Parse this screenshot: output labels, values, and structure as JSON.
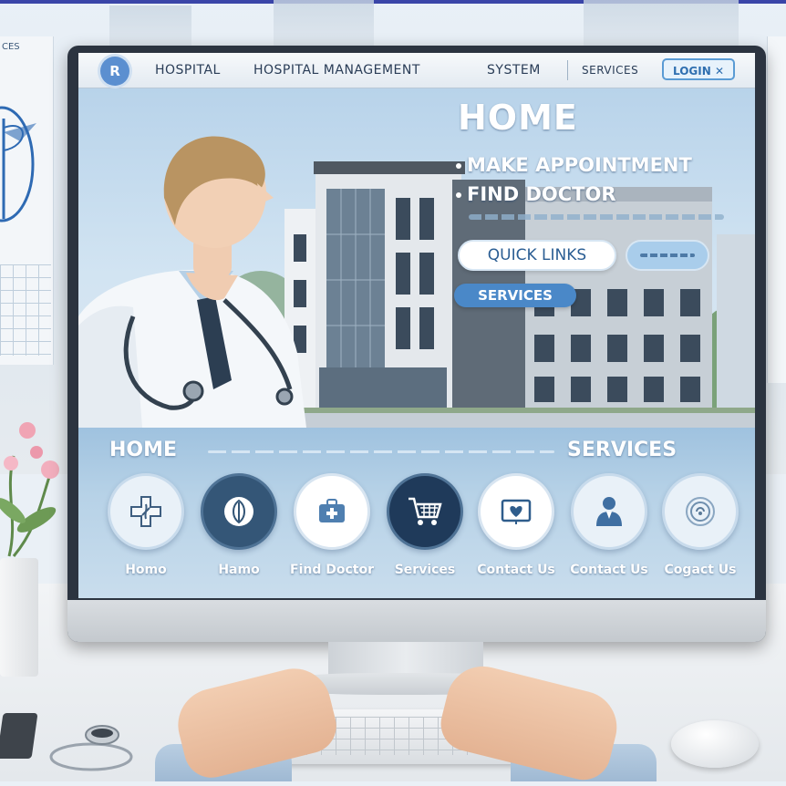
{
  "header": {
    "logo_glyph": "R",
    "brand": "HOSPITAL",
    "title": "HOSPITAL MANAGEMENT",
    "subtitle": "SYSTEM",
    "services_link": "SERVICES",
    "login_label": "LOGIN ✕"
  },
  "hero": {
    "title": "HOME",
    "links": [
      "MAKE APPOINTMENT",
      "FIND DOCTOR"
    ],
    "quick_links_label": "QUICK LINKS",
    "services_label": "SERVICES"
  },
  "lower": {
    "home_heading": "HOME",
    "services_heading": "SERVICES",
    "items": [
      {
        "label": "Homo",
        "icon": "plus-icon"
      },
      {
        "label": "Hamo",
        "icon": "leaf-icon"
      },
      {
        "label": "Find Doctor",
        "icon": "medical-kit-icon"
      },
      {
        "label": "Services",
        "icon": "cart-icon"
      },
      {
        "label": "Contact Us",
        "icon": "heart-monitor-icon"
      },
      {
        "label": "Contact Us",
        "icon": "doctor-icon"
      },
      {
        "label": "Cogact Us",
        "icon": "fingerprint-icon"
      }
    ]
  },
  "background": {
    "left_panel_text": "CES"
  },
  "colors": {
    "accent": "#4a88c8",
    "header_text": "#2a3d57",
    "screen_bg": "#dfeaf4"
  }
}
